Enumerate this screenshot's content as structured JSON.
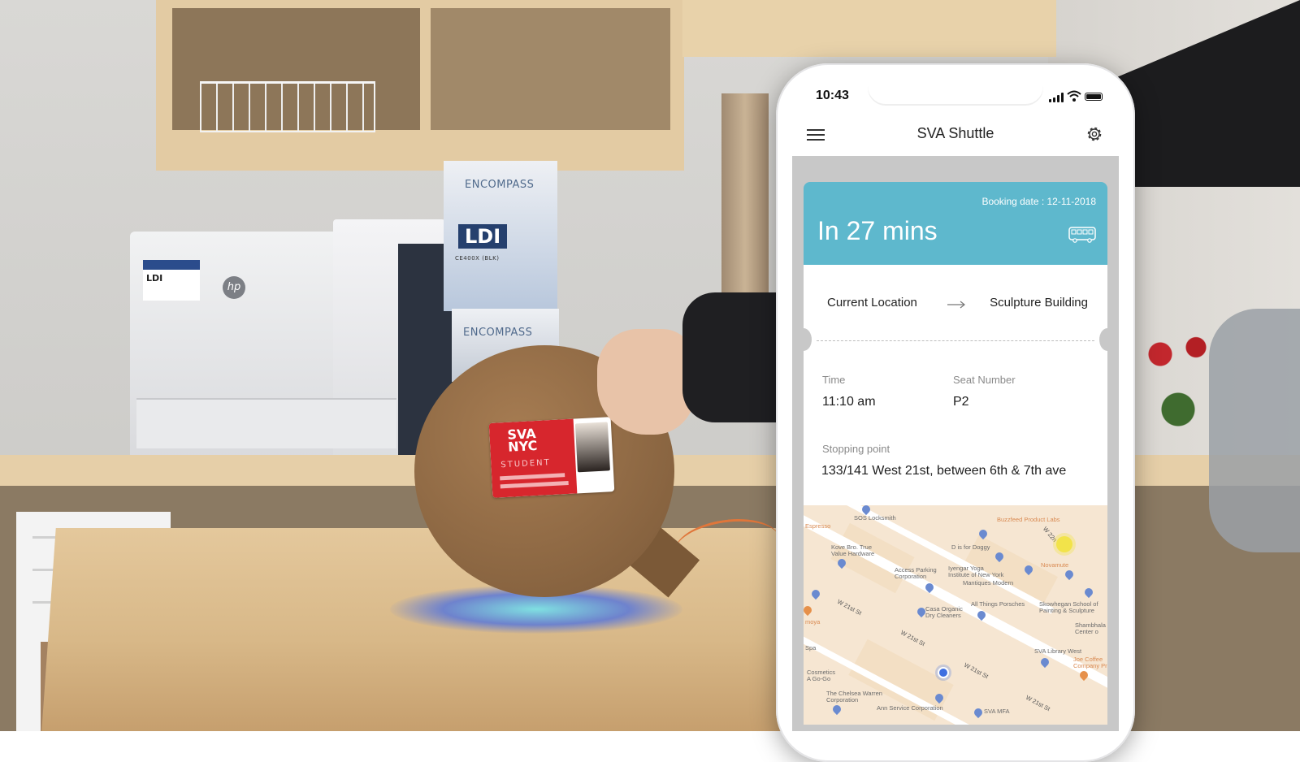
{
  "status_bar": {
    "time": "10:43"
  },
  "app": {
    "title": "SVA Shuttle"
  },
  "ticket": {
    "booking_label": "Booking date : 12-11-2018",
    "eta": "In 27 mins",
    "from": "Current Location",
    "to": "Sculpture Building",
    "time_label": "Time",
    "time_value": "11:10 am",
    "seat_label": "Seat Number",
    "seat_value": "P2",
    "stop_label": "Stopping point",
    "stop_value": "133/141 West 21st, between 6th & 7th ave"
  },
  "map": {
    "labels": {
      "sos": "SOS Locksmith",
      "buzzfeed": "Buzzfeed Product Labs",
      "espresso": "Espresso",
      "doggy": "D is for Doggy",
      "kove": "Kove Bro. True\nValue Hardware",
      "access": "Access Parking\nCorporation",
      "iyengar": "Iyengar Yoga\nInstitute of New York",
      "mantiques": "Mantiques Modern",
      "novamute": "Novamute",
      "allthings": "All Things Porsches",
      "skowhegan": "Skowhegan School of\nPainting & Sculpture",
      "casa": "Casa Organic\nDry Cleaners",
      "moya": "moya",
      "shambhala": "Shambhala\nCenter o",
      "spa": "Spa",
      "library": "SVA Library West",
      "joe": "Joe Coffee\nCompany Pr",
      "cosmetics": "Cosmetics\nA Go-Go",
      "chelsea": "The Chelsea Warren\nCorporation",
      "ann": "Ann Service Corporation",
      "svamfa": "SVA MFA",
      "w21_a": "W 21st St",
      "w21_b": "W 21st St",
      "w21_c": "W 21st St",
      "w21_d": "W 21st St",
      "w22": "W 22n"
    }
  },
  "backdrop": {
    "box_brand": "ENCOMPASS",
    "box_logo": "LDI",
    "box_model": "CE400X (BLK)",
    "printer_brand": "hp",
    "label_logo": "LDI",
    "card_logo": "SVA NYC",
    "card_role": "STUDENT"
  },
  "colors": {
    "ticket_header": "#5eb8cd",
    "user_location": "#3f6fe0",
    "shuttle_location": "#f2e34a"
  },
  "icons": [
    "menu-icon",
    "gear-icon",
    "bus-icon",
    "arrow-right-icon",
    "signal-icon",
    "wifi-icon",
    "battery-icon"
  ]
}
